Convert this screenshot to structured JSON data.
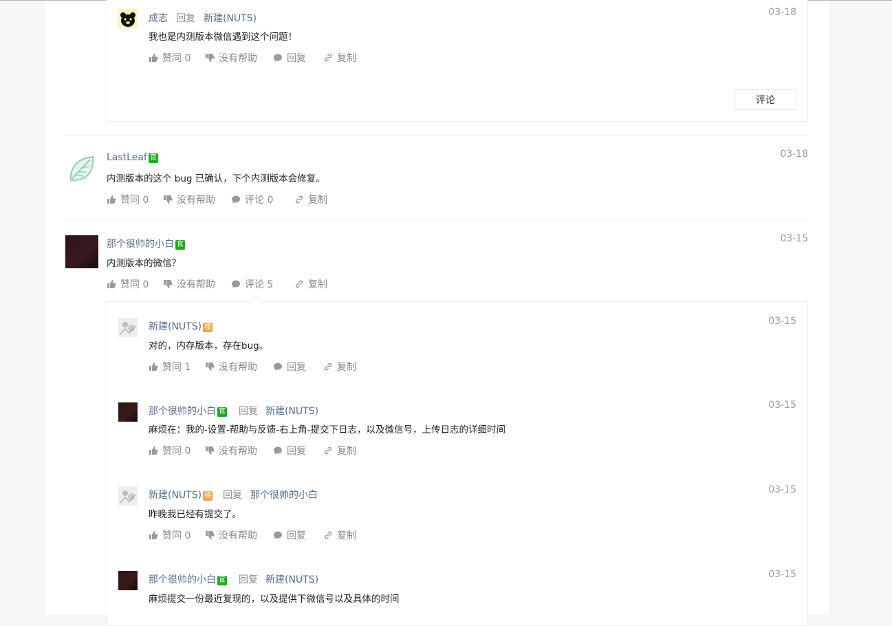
{
  "thread1_reply": {
    "author": "成志",
    "reply_word": "回复",
    "target": "新建(NUTS)",
    "date": "03-18",
    "content": "我也是内测版本微信遇到这个问题！",
    "actions": {
      "like": "赞同 0",
      "unhelpful": "没有帮助",
      "reply": "回复",
      "copy": "复制"
    },
    "comment_button": "评论"
  },
  "answer1": {
    "author": "LastLeaf",
    "badge": "官",
    "date": "03-18",
    "content": "内测版本的这个 bug 已确认，下个内测版本会修复。",
    "actions": {
      "like": "赞同 0",
      "unhelpful": "没有帮助",
      "comment": "评论 0",
      "copy": "复制"
    }
  },
  "answer2": {
    "author": "那个很帅的小白",
    "badge": "官",
    "date": "03-15",
    "content": "内测版本的微信？",
    "actions": {
      "like": "赞同 0",
      "unhelpful": "没有帮助",
      "comment": "评论 5",
      "copy": "复制"
    }
  },
  "replies": [
    {
      "author": "新建(NUTS)",
      "badge": "楼",
      "reply_word": "",
      "target": "",
      "date": "03-15",
      "content": "对的，内存版本，存在bug。",
      "like": "赞同 1",
      "unhelpful": "没有帮助",
      "reply": "回复",
      "copy": "复制"
    },
    {
      "author": "那个很帅的小白",
      "badge": "官",
      "reply_word": "回复",
      "target": "新建(NUTS)",
      "date": "03-15",
      "content": "麻烦在：我的-设置-帮助与反馈-右上角-提交下日志，以及微信号，上传日志的详细时间",
      "like": "赞同 0",
      "unhelpful": "没有帮助",
      "reply": "回复",
      "copy": "复制"
    },
    {
      "author": "新建(NUTS)",
      "badge": "楼",
      "reply_word": "回复",
      "target": "那个很帅的小白",
      "date": "03-15",
      "content": "昨晚我已经有提交了。",
      "like": "赞同 0",
      "unhelpful": "没有帮助",
      "reply": "回复",
      "copy": "复制"
    },
    {
      "author": "那个很帅的小白",
      "badge": "官",
      "reply_word": "回复",
      "target": "新建(NUTS)",
      "date": "03-15",
      "content": "麻烦提交一份最近复现的，以及提供下微信号以及具体的时间",
      "like": "",
      "unhelpful": "",
      "reply": "",
      "copy": ""
    }
  ],
  "colors": {
    "link": "#576b95",
    "official": "#1aad19",
    "floor": "#f0a540",
    "muted": "#8a8a8a"
  },
  "icons": [
    "thumbs-up-icon",
    "thumbs-down-icon",
    "comment-bubble-icon",
    "link-icon"
  ]
}
